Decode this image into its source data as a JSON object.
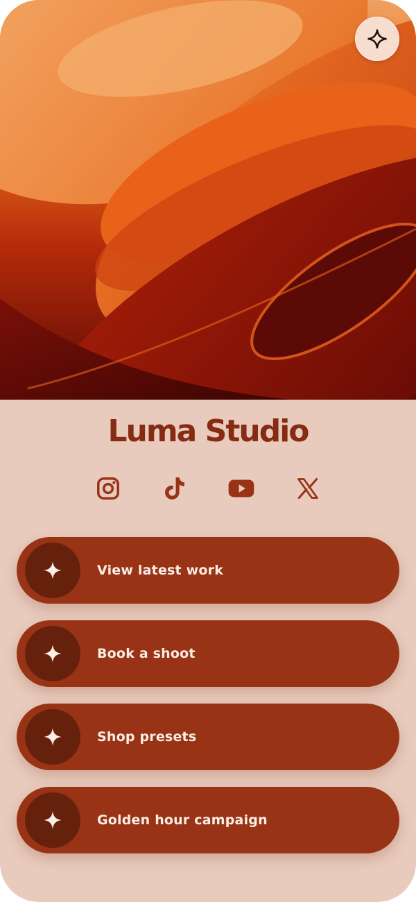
{
  "profile": {
    "name": "Luma Studio"
  },
  "header": {
    "sparkle_icon": "sparkle-icon"
  },
  "socials": [
    {
      "name": "Instagram",
      "icon": "instagram-icon"
    },
    {
      "name": "TikTok",
      "icon": "tiktok-icon"
    },
    {
      "name": "YouTube",
      "icon": "youtube-icon"
    },
    {
      "name": "X",
      "icon": "x-icon"
    }
  ],
  "links": [
    {
      "label": "View latest work",
      "icon": "sparkle-icon"
    },
    {
      "label": "Book a shoot",
      "icon": "sparkle-icon"
    },
    {
      "label": "Shop presets",
      "icon": "sparkle-icon"
    },
    {
      "label": "Golden hour campaign",
      "icon": "sparkle-icon"
    }
  ],
  "colors": {
    "background": "#e8cbbd",
    "accent": "#983315",
    "accent_dark": "#66210d",
    "title": "#852c13",
    "link_text": "#fbeee6"
  }
}
